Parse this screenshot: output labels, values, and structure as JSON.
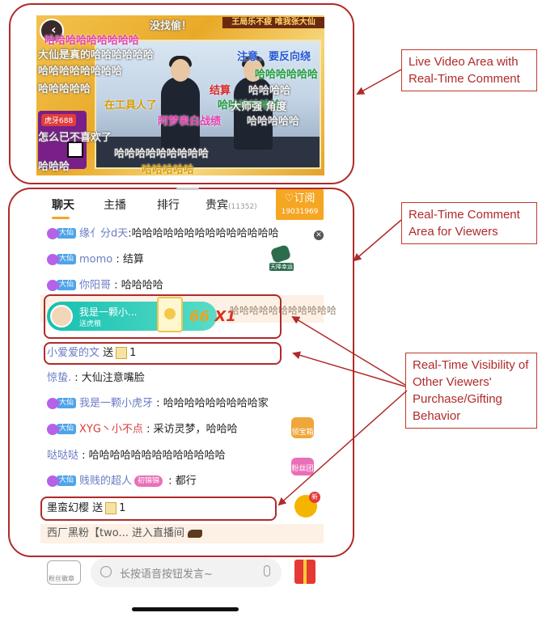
{
  "annotations": {
    "live_video": "Live Video Area with Real-Time Comment",
    "comment_area": "Real-Time Comment Area for Viewers",
    "visibility": "Real-Time Visibility of Other Viewers' Purchase/Gifting Behavior"
  },
  "video": {
    "top_banner": "王局乐不疲 唯我张大仙",
    "left_tag": "虎牙688",
    "danmu": [
      "没找偷！",
      "哈哈哈哈哈哈哈哈哈",
      "大仙是真的哈哈哈哈哈哈",
      "注意，要反向绕",
      "哈哈哈哈哈哈哈哈",
      "哈哈哈哈哈哈",
      "哈哈哈哈哈",
      "结算",
      "哈哈哈哈",
      "在工具人了",
      "哈哈哈哈哈哈",
      "阿梦表白战绩",
      "哈哈哈哈哈",
      "怎么已不喜欢了",
      "大师强 角度",
      "哈哈哈哈哈哈哈哈哈",
      "哈哈哈",
      "哈哈哈哈哈"
    ]
  },
  "tabs": [
    {
      "label": "聊天"
    },
    {
      "label": "主播"
    },
    {
      "label": "排行"
    },
    {
      "label": "贵宾",
      "count": "(11352)"
    }
  ],
  "subscribe": {
    "label": "♡订阅",
    "count": "19031969"
  },
  "comments": [
    {
      "badge": "大仙",
      "name": "缘亻分d天",
      "text": "哈哈哈哈哈哈哈哈哈哈哈哈哈哈"
    },
    {
      "badge": "大仙",
      "name": "momo",
      "text": "结算"
    },
    {
      "badge": "大仙",
      "name": "你阳哥",
      "text": "哈哈哈哈"
    },
    {
      "name": "惊蛰.",
      "text": "大仙注意嘴脸"
    },
    {
      "badge": "大仙",
      "name": "我是一颗小虎牙",
      "text": "哈哈哈哈哈哈哈哈哈家"
    },
    {
      "badge": "大仙",
      "name": "XYG丶小不点",
      "text": "采访灵梦，哈哈哈"
    },
    {
      "name": "哒哒哒",
      "text": "哈哈哈哈哈哈哈哈哈哈哈哈哈"
    },
    {
      "badge": "大仙",
      "name": "贱贱的超人",
      "fan_badge": "初锦锦",
      "text": "都行"
    }
  ],
  "gift_pill": {
    "who": "我是一颗小...",
    "sub": "送虎粮",
    "combo": "66",
    "times": "X1",
    "bg_text": "哈哈哈哈哈哈哈哈哈哈哈"
  },
  "gift_rows": [
    {
      "name": "小爱爱的文",
      "action": "送",
      "count": "1"
    },
    {
      "name": "墨蛮幻樱",
      "action": "送",
      "count": "1"
    }
  ],
  "enter_row": {
    "text": "西厂黑粉【two... 进入直播间"
  },
  "side": {
    "bag": "天降幸运袋",
    "treasure": "领宝箱",
    "fans": "粉丝团",
    "new": "新"
  },
  "input": {
    "placeholder": "长按语音按钮发言~",
    "fans_label": "粉丝徽章"
  }
}
